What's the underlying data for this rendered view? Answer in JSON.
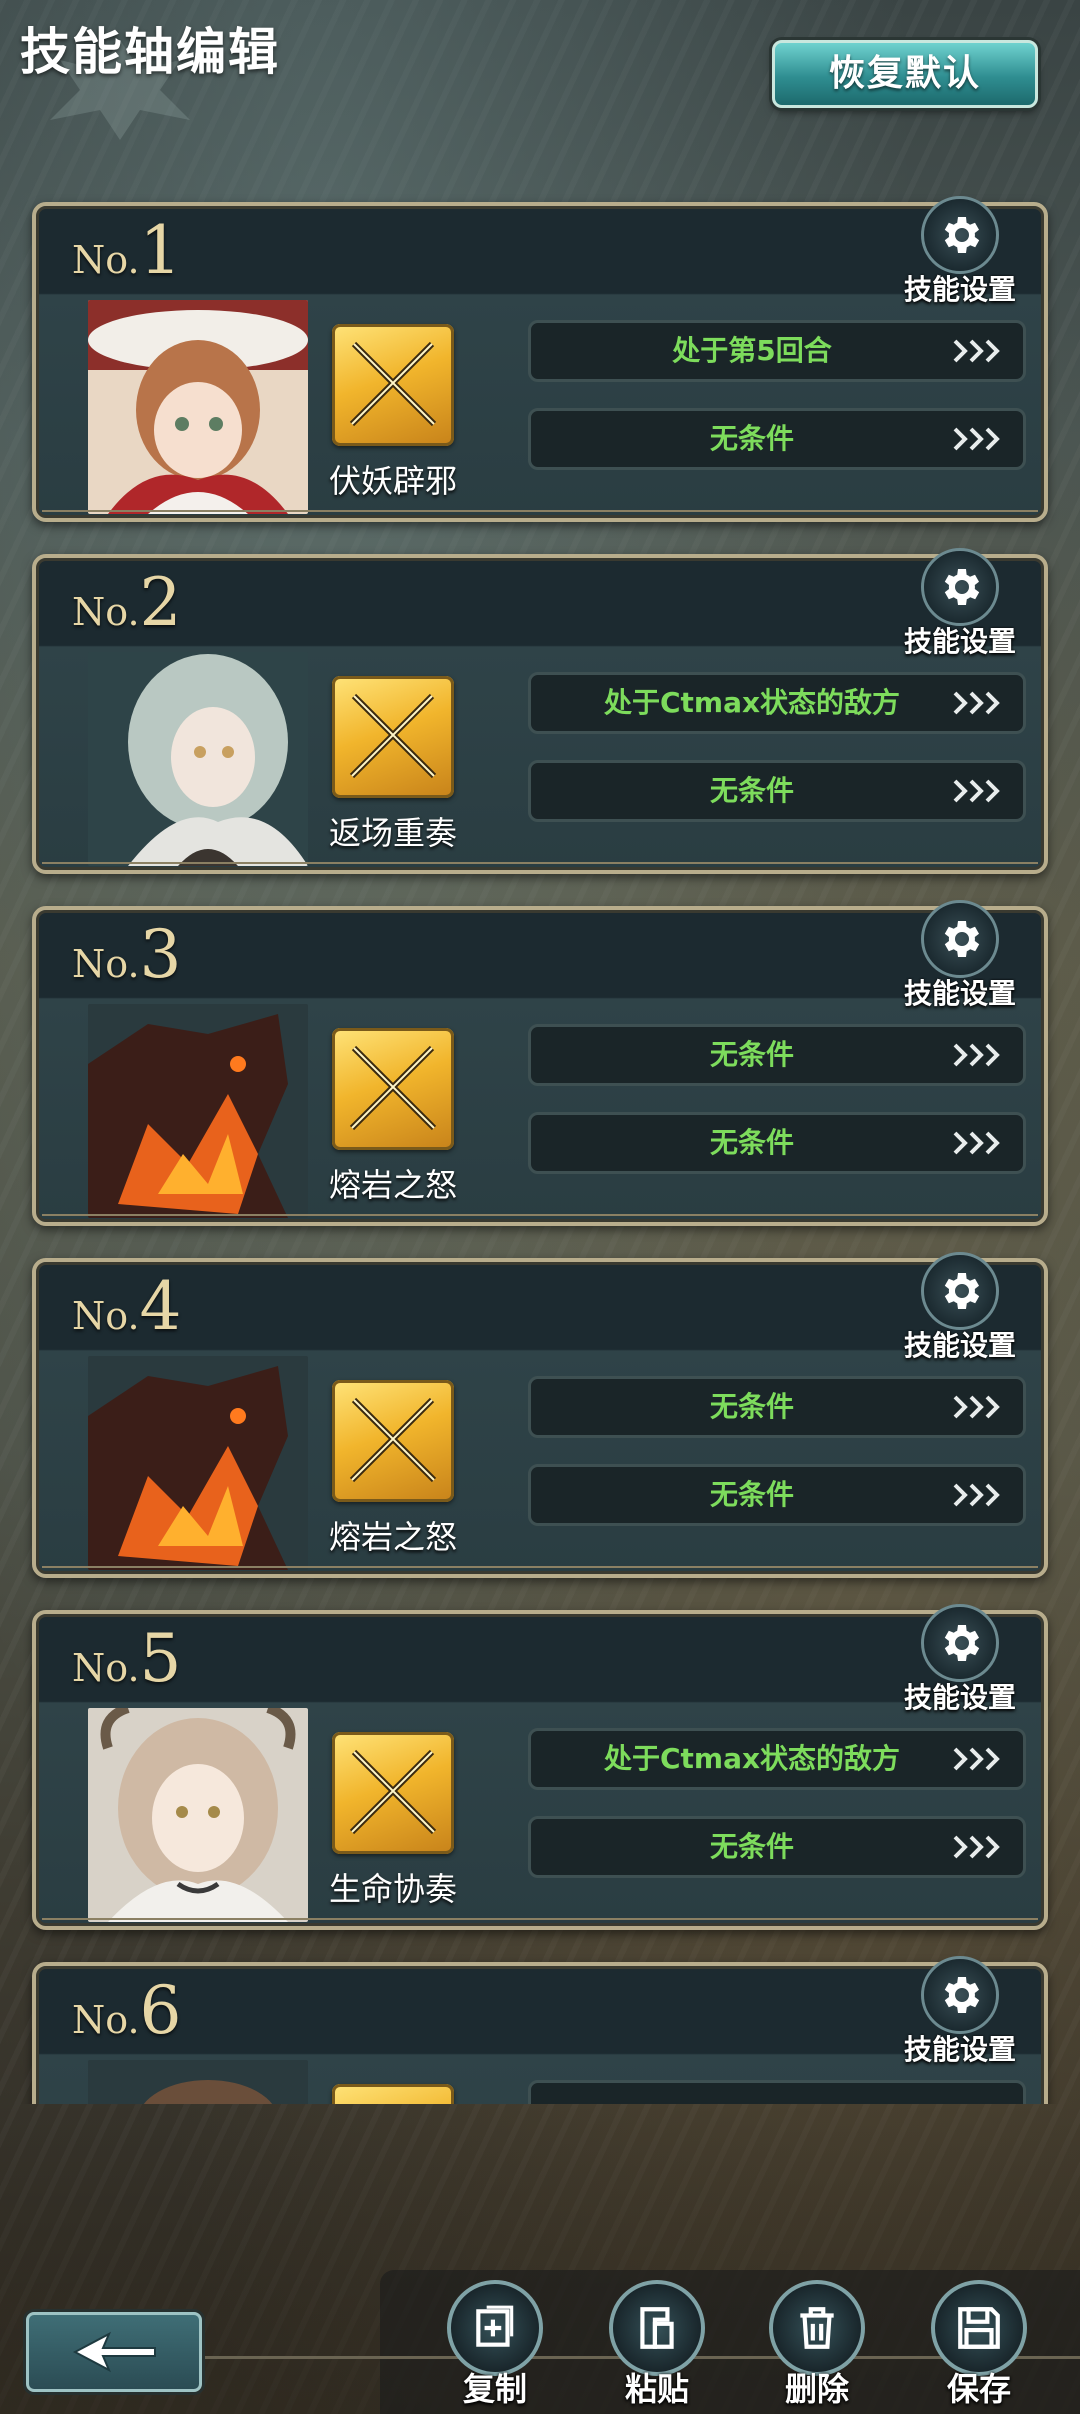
{
  "header": {
    "title": "技能轴编辑",
    "reset_label": "恢复默认"
  },
  "settings_label": "技能设置",
  "cards": [
    {
      "no_prefix": "No.",
      "no_num": "1",
      "skill_name": "伏妖辟邪",
      "portrait": "girl-red-hood",
      "cond1": "处于第5回合",
      "cond2": "无条件"
    },
    {
      "no_prefix": "No.",
      "no_num": "2",
      "skill_name": "返场重奏",
      "portrait": "girl-silver-hair",
      "cond1": "处于Ctmax状态的敌方",
      "cond2": "无条件"
    },
    {
      "no_prefix": "No.",
      "no_num": "3",
      "skill_name": "熔岩之怒",
      "portrait": "lava-dragon",
      "cond1": "无条件",
      "cond2": "无条件"
    },
    {
      "no_prefix": "No.",
      "no_num": "4",
      "skill_name": "熔岩之怒",
      "portrait": "lava-dragon",
      "cond1": "无条件",
      "cond2": "无条件"
    },
    {
      "no_prefix": "No.",
      "no_num": "5",
      "skill_name": "生命协奏",
      "portrait": "girl-antlers",
      "cond1": "处于Ctmax状态的敌方",
      "cond2": "无条件"
    },
    {
      "no_prefix": "No.",
      "no_num": "6",
      "skill_name": "",
      "portrait": "girl-brown-hair",
      "cond1": "",
      "cond2": ""
    }
  ],
  "toolbar": {
    "copy_label": "复制",
    "paste_label": "粘贴",
    "delete_label": "删除",
    "save_label": "保存"
  },
  "colors": {
    "condition_text": "#7ddc5c",
    "number_gold": "#e6d6a6",
    "accent_teal": "#2f8e91"
  }
}
